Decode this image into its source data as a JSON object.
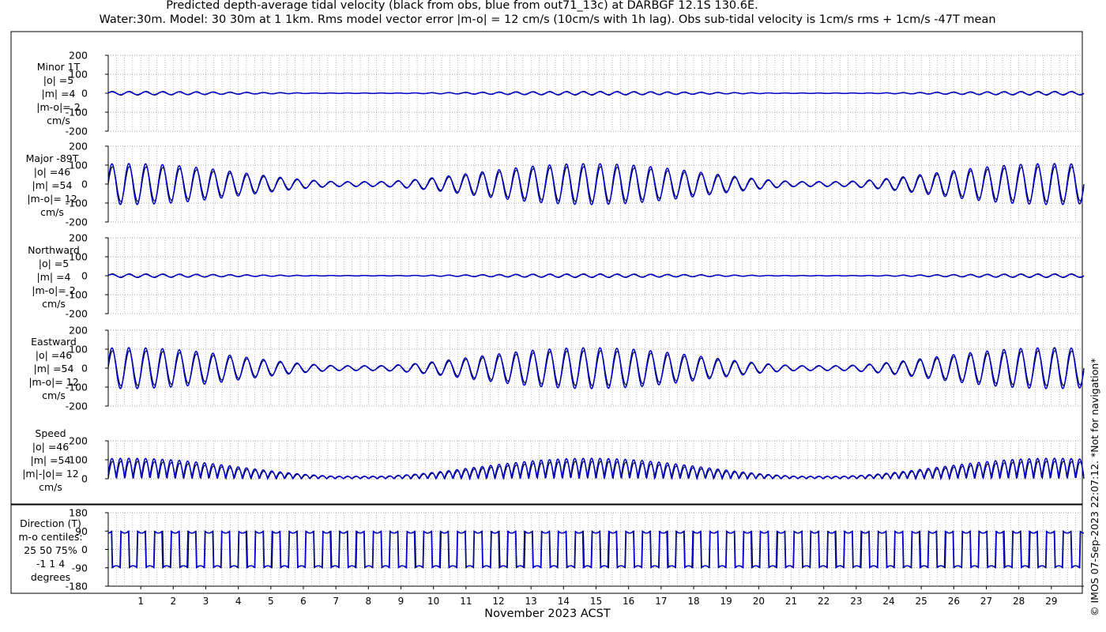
{
  "title": {
    "line1": "Predicted depth-average tidal velocity (black from obs, blue from out71_13c) at DARBGF 12.1S 130.6E.",
    "line2": "Water:30m. Model: 30 30m at 1 1km. Rms model vector error |m-o| = 12 cm/s (10cm/s with 1h lag). Obs sub-tidal velocity is 1cm/s rms + 1cm/s -47T mean"
  },
  "credit": "© IMOS 07-Sep-2023 22:07:12. *Not for navigation*",
  "colors": {
    "obs": "#000000",
    "model": "#0000cc",
    "grid": "#888888"
  },
  "chart_data": [
    {
      "type": "line",
      "panel": "minor",
      "label_lines": [
        "Minor 1T",
        "|o| =5",
        "|m| =4",
        "|m-o|= 2",
        "cm/s"
      ],
      "ylim": [
        -200,
        200
      ],
      "yticks": [
        -200,
        -100,
        0,
        100,
        200
      ],
      "xlim": [
        0,
        30
      ],
      "series": [
        {
          "role": "obs",
          "amplitude": 5,
          "offset": 0
        },
        {
          "role": "model",
          "amplitude": 4,
          "offset": 0
        }
      ]
    },
    {
      "type": "line",
      "panel": "major",
      "label_lines": [
        "Major -89T",
        "|o| =46",
        "|m| =54",
        "|m-o|= 12",
        "cm/s"
      ],
      "ylim": [
        -200,
        200
      ],
      "yticks": [
        -200,
        -100,
        0,
        100,
        200
      ],
      "xlim": [
        0,
        30
      ],
      "series": [
        {
          "role": "obs",
          "amplitude": 46,
          "offset": 0
        },
        {
          "role": "model",
          "amplitude": 54,
          "offset": 0
        }
      ]
    },
    {
      "type": "line",
      "panel": "northward",
      "label_lines": [
        "Northward",
        "|o| =5",
        "|m| =4",
        "|m-o|= 2",
        "cm/s"
      ],
      "ylim": [
        -200,
        200
      ],
      "yticks": [
        -200,
        -100,
        0,
        100,
        200
      ],
      "xlim": [
        0,
        30
      ],
      "series": [
        {
          "role": "obs",
          "amplitude": 5,
          "offset": 0
        },
        {
          "role": "model",
          "amplitude": 4,
          "offset": 0
        }
      ]
    },
    {
      "type": "line",
      "panel": "eastward",
      "label_lines": [
        "Eastward",
        "|o| =46",
        "|m| =54",
        "|m-o|= 12",
        "cm/s"
      ],
      "ylim": [
        -200,
        200
      ],
      "yticks": [
        -200,
        -100,
        0,
        100,
        200
      ],
      "xlim": [
        0,
        30
      ],
      "series": [
        {
          "role": "obs",
          "amplitude": 46,
          "offset": 0
        },
        {
          "role": "model",
          "amplitude": 54,
          "offset": 0
        }
      ]
    },
    {
      "type": "line",
      "panel": "speed",
      "label_lines": [
        "Speed",
        "|o| =46",
        "|m| =54",
        "|m|-|o|= 12",
        "cm/s"
      ],
      "ylim": [
        0,
        200
      ],
      "yticks": [
        0,
        100,
        200
      ],
      "xlim": [
        0,
        30
      ],
      "series": [
        {
          "role": "obs",
          "amplitude": 46,
          "offset": 0
        },
        {
          "role": "model",
          "amplitude": 54,
          "offset": 0
        }
      ]
    },
    {
      "type": "line",
      "panel": "direction",
      "label_lines": [
        "Direction (T)",
        "m-o centiles:",
        "25  50  75%",
        "-1  1  4",
        "degrees"
      ],
      "ylim": [
        -180,
        180
      ],
      "yticks": [
        -180,
        -90,
        0,
        90,
        180
      ],
      "xlim": [
        0,
        30
      ],
      "centiles": {
        "p25": -1,
        "p50": 1,
        "p75": 4
      },
      "series": [
        {
          "role": "obs",
          "upper": 90,
          "lower": -90
        },
        {
          "role": "model",
          "upper": 90,
          "lower": -90
        }
      ]
    }
  ],
  "xaxis": {
    "label": "November 2023 ACST",
    "ticks": [
      "1",
      "2",
      "3",
      "4",
      "5",
      "6",
      "7",
      "8",
      "9",
      "10",
      "11",
      "12",
      "13",
      "14",
      "15",
      "16",
      "17",
      "18",
      "19",
      "20",
      "21",
      "22",
      "23",
      "24",
      "25",
      "26",
      "27",
      "28",
      "29"
    ],
    "tick_values": [
      1,
      2,
      3,
      4,
      5,
      6,
      7,
      8,
      9,
      10,
      11,
      12,
      13,
      14,
      15,
      16,
      17,
      18,
      19,
      20,
      21,
      22,
      23,
      24,
      25,
      26,
      27,
      28,
      29
    ]
  }
}
